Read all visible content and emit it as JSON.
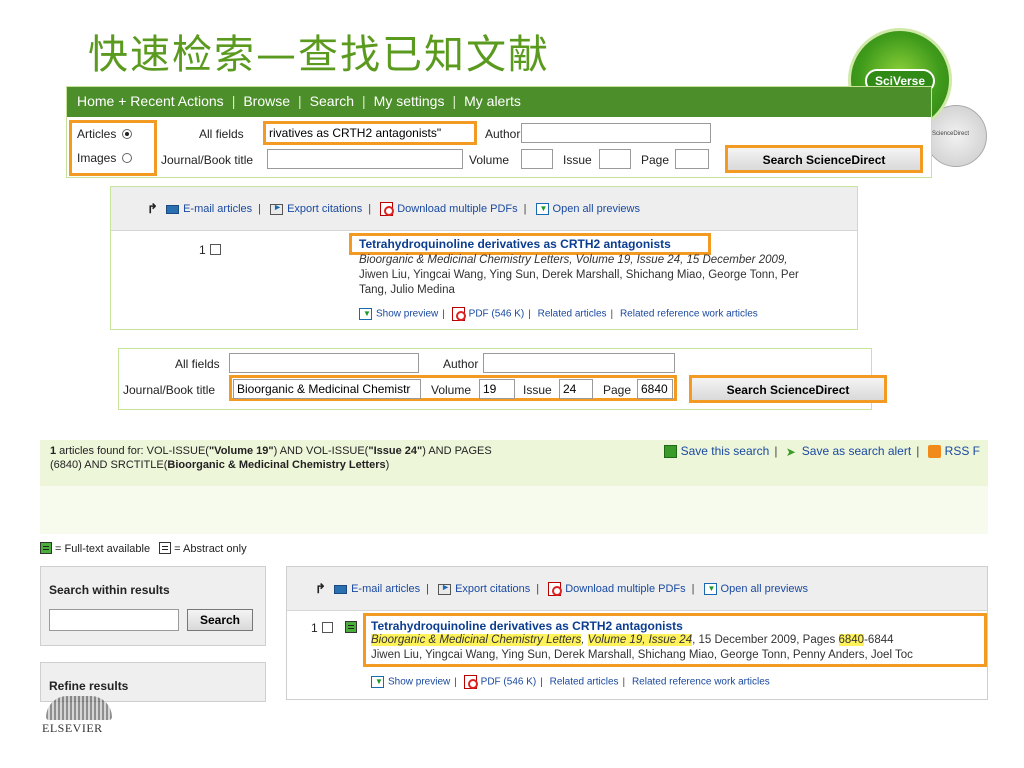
{
  "slide": {
    "title": "快速检索—查找已知文献",
    "sciverse_badge": "SciVerse",
    "sciencedirect_badge": "ScienceDirect",
    "publisher": "ELSEVIER"
  },
  "nav": {
    "items": [
      "Home + Recent Actions",
      "Browse",
      "Search",
      "My settings",
      "My alerts"
    ],
    "separator": "|"
  },
  "search1": {
    "articles_label": "Articles",
    "images_label": "Images",
    "selected": "Articles",
    "all_fields_label": "All fields",
    "all_fields_value": "rivatives as CRTH2 antagonists\"",
    "author_label": "Author",
    "author_value": "",
    "journal_label": "Journal/Book title",
    "journal_value": "",
    "volume_label": "Volume",
    "volume_value": "",
    "issue_label": "Issue",
    "issue_value": "",
    "page_label": "Page",
    "page_value": "",
    "button": "Search ScienceDirect"
  },
  "toolbar": {
    "email": "E-mail articles",
    "export": "Export citations",
    "download": "Download multiple PDFs",
    "open_previews": "Open all previews",
    "sep": "|"
  },
  "result1": {
    "number": "1",
    "title": "Tetrahydroquinoline derivatives as CRTH2 antagonists",
    "citation": "Bioorganic & Medicinal Chemistry Letters, Volume 19, Issue 24, 15 December 2009, ",
    "authors_line1": "Jiwen Liu, Yingcai Wang, Ying Sun, Derek Marshall, Shichang Miao, George Tonn, Per",
    "authors_line2": "Tang, Julio Medina",
    "show_preview": "Show preview",
    "pdf": "PDF (546 K)",
    "related": "Related articles",
    "related_ref": "Related reference work articles"
  },
  "search2": {
    "all_fields_label": "All fields",
    "all_fields_value": "",
    "author_label": "Author",
    "author_value": "",
    "journal_label": "Journal/Book title",
    "journal_value": "Bioorganic & Medicinal Chemistr",
    "volume_label": "Volume",
    "volume_value": "19",
    "issue_label": "Issue",
    "issue_value": "24",
    "page_label": "Page",
    "page_value": "6840",
    "button": "Search ScienceDirect"
  },
  "found": {
    "count": "1",
    "q1": " articles found for: VOL-ISSUE(",
    "q2": "\"Volume 19\"",
    "q3": ") AND VOL-ISSUE(",
    "q4": "\"Issue 24\"",
    "q5": ") AND PAGES",
    "q6": "(6840",
    "q7": ") AND SRCTITLE(",
    "q8": "Bioorganic & Medicinal Chemistry Letters",
    "q9": ")",
    "save_search": "Save this search",
    "save_alert": "Save as search alert",
    "rss": "RSS F",
    "sep": "|"
  },
  "legend": {
    "full_text": "= Full-text available",
    "abstract": "= Abstract only"
  },
  "sidebar": {
    "search_within": "Search within results",
    "search_input": "",
    "search_button": "Search",
    "refine": "Refine results"
  },
  "result2": {
    "number": "1",
    "title": "Tetrahydroquinoline derivatives as CRTH2 antagonists",
    "journal": "Bioorganic & Medicinal Chemistry Letters",
    "comma1": ", ",
    "volume_issue": "Volume 19, Issue 24",
    "date_pages": ", 15 December 2009, Pages ",
    "page_start": "6840",
    "page_end": "-6844",
    "authors": "Jiwen Liu, Yingcai Wang, Ying Sun, Derek Marshall, Shichang Miao, George Tonn, Penny Anders, Joel Toc",
    "show_preview": "Show preview",
    "pdf": "PDF (546 K)",
    "related": "Related articles",
    "related_ref": "Related reference work articles"
  }
}
